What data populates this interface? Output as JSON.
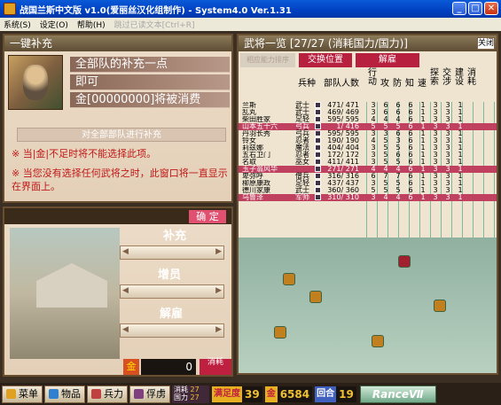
{
  "window": {
    "title": "战国兰斯中文版 v1.0(爱丽丝汉化组制作) - System4.0 Ver.1.31",
    "min": "_",
    "max": "□",
    "close": "✕"
  },
  "menu": {
    "items": [
      "系统(S)",
      "设定(O)",
      "帮助(H)"
    ],
    "disabled": "跳过已读文本[Ctrl+R]"
  },
  "resupply": {
    "title": "一键补充",
    "line1": "全部队的补充一点",
    "line2": "即可",
    "line3": "金[00000000]将被消费",
    "button": "对全部部队进行补充",
    "note1": "※ 当|金|不足时将不能选择此项。",
    "note2": "※ 当您没有选择任何武将之时，此窗口将一直显示在界面上。"
  },
  "generals": {
    "title": "武将一览 [27/27 (消耗国力/国力)]",
    "close": "关闭",
    "tabs": [
      "相应能力排序",
      "交换位置",
      "解雇"
    ],
    "headers": [
      "兵种",
      "部队人数",
      "行动",
      "攻",
      "防",
      "知",
      "速",
      "探索",
      "交涉",
      "建设",
      "消耗"
    ],
    "rows": [
      {
        "name": "兰斯",
        "type": "武士",
        "troops": "471/ 471",
        "s": [
          "3",
          "6",
          "6",
          "6",
          "1",
          "3",
          "3",
          "1"
        ]
      },
      {
        "name": "乱丸",
        "type": "武士",
        "troops": "469/ 469",
        "s": [
          "3",
          "6",
          "6",
          "6",
          "1",
          "3",
          "3",
          "1"
        ]
      },
      {
        "name": "柴田胜家",
        "type": "足轻",
        "troops": "595/ 595",
        "s": [
          "4",
          "4",
          "4",
          "6",
          "1",
          "3",
          "3",
          "1"
        ]
      },
      {
        "name": "山本五十六",
        "type": "弓兵",
        "troops": "1/ 416",
        "s": [
          "5",
          "5",
          "5",
          "6",
          "1",
          "3",
          "3",
          "1"
        ],
        "hl": true
      },
      {
        "name": "丹羽长秀",
        "type": "弓兵",
        "troops": "595/ 595",
        "s": [
          "3",
          "3",
          "6",
          "6",
          "1",
          "3",
          "3",
          "1"
        ]
      },
      {
        "name": "铃女",
        "type": "忍者",
        "troops": "190/ 190",
        "s": [
          "4",
          "5",
          "3",
          "6",
          "1",
          "3",
          "3",
          "1"
        ]
      },
      {
        "name": "莉兹娜",
        "type": "魔法",
        "troops": "404/ 404",
        "s": [
          "3",
          "5",
          "5",
          "6",
          "1",
          "3",
          "3",
          "1"
        ]
      },
      {
        "name": "五右卫门",
        "type": "忍者",
        "troops": "172/ 172",
        "s": [
          "3",
          "5",
          "6",
          "6",
          "1",
          "3",
          "3",
          "1"
        ]
      },
      {
        "name": "名取",
        "type": "巫女",
        "troops": "411/ 411",
        "s": [
          "3",
          "5",
          "5",
          "6",
          "1",
          "3",
          "3",
          "1"
        ]
      },
      {
        "name": "玉子翁风华",
        "type": "",
        "troops": "271/ 271",
        "s": [
          "4",
          "4",
          "4",
          "6",
          "1",
          "3",
          "3",
          "1"
        ],
        "hl": true
      },
      {
        "name": "卑弥呼",
        "type": "僧兵",
        "troops": "316/ 316",
        "s": [
          "6",
          "7",
          "7",
          "6",
          "1",
          "3",
          "3",
          "1"
        ]
      },
      {
        "name": "柳原康政",
        "type": "足轻",
        "troops": "437/ 437",
        "s": [
          "3",
          "5",
          "5",
          "6",
          "1",
          "3",
          "3",
          "1"
        ]
      },
      {
        "name": "德川家康",
        "type": "武士",
        "troops": "360/ 360",
        "s": [
          "5",
          "5",
          "5",
          "6",
          "1",
          "3",
          "3",
          "1"
        ]
      },
      {
        "name": "乌鲁泽",
        "type": "军师",
        "troops": "310/ 310",
        "s": [
          "3",
          "4",
          "4",
          "6",
          "1",
          "3",
          "3",
          "1"
        ],
        "hl": true
      }
    ]
  },
  "recruit": {
    "ok": "确 定",
    "supply": "补充",
    "add": "增员",
    "fire": "解雇",
    "gold_icon": "金",
    "gold": "0",
    "consume": "消耗"
  },
  "bottom": {
    "menu": "菜单",
    "items": "物品",
    "troops": "兵力",
    "prisoner": "俘虏",
    "mini1": "消耗",
    "mini1v": "27",
    "mini2": "国力",
    "mini2v": "27",
    "satisfaction": "满足度",
    "sat_val": "39",
    "gold_lab": "金",
    "gold_val": "6584",
    "turn_lab": "回合",
    "turn_val": "19",
    "rance": "RanceⅦ"
  }
}
